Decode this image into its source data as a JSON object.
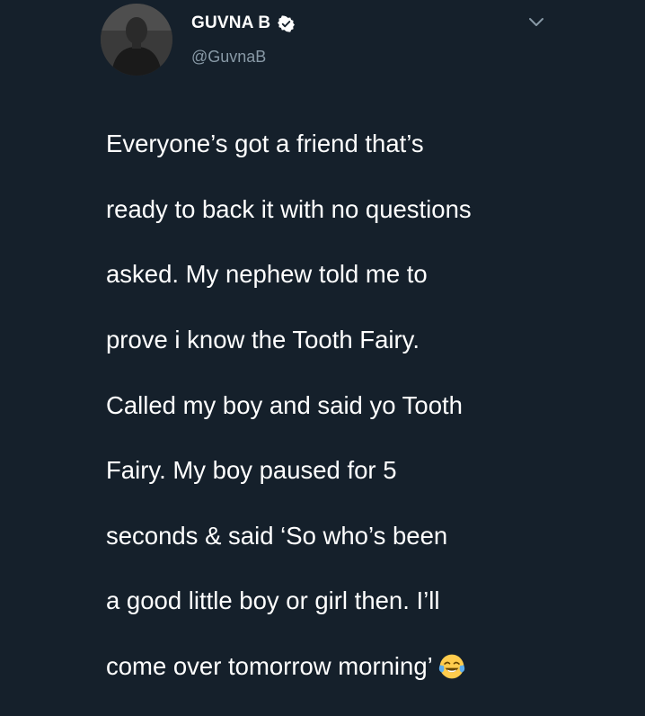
{
  "tweet": {
    "display_name": "GUVNA B",
    "handle": "@GuvnaB",
    "verified": true,
    "text_lines": [
      "Everyone’s got a friend that’s",
      "ready to back it with no questions",
      "asked. My nephew told me to",
      "prove i know the Tooth Fairy.",
      "Called my boy and said yo Tooth",
      "Fairy. My boy paused for 5",
      "seconds & said ‘So who’s been",
      "a good little boy or girl then. I’ll",
      "come over tomorrow morning’"
    ],
    "emoji": "face-with-tears-of-joy-icon"
  },
  "colors": {
    "background": "#15202b",
    "text": "#ffffff",
    "secondary_text": "#8899a6",
    "verified": "#ffffff"
  }
}
